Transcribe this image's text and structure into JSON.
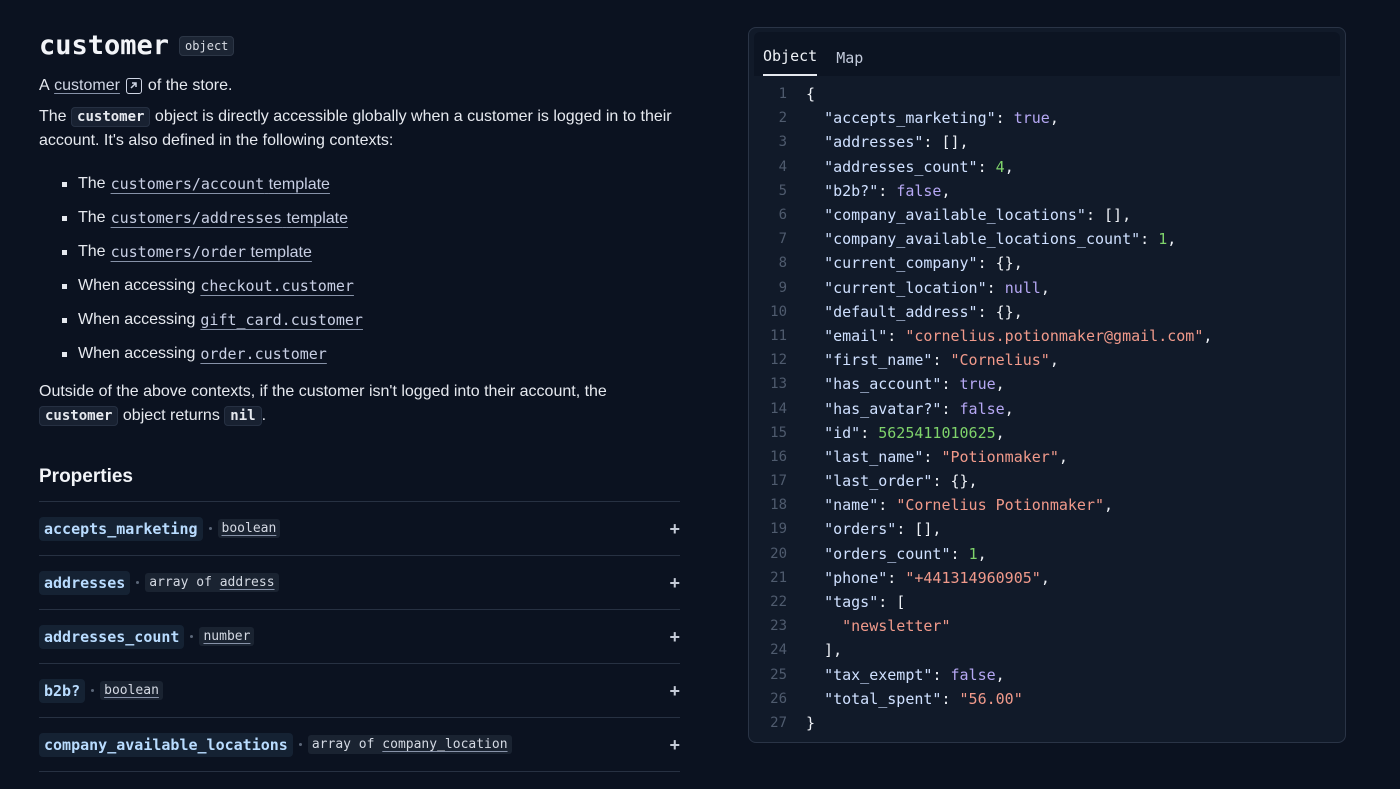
{
  "header": {
    "title": "customer",
    "type_badge": "object"
  },
  "intro": {
    "prefix": "A",
    "link": "customer",
    "suffix": "of the store."
  },
  "description": {
    "p1_before": "The",
    "p1_code": "customer",
    "p1_after": "object is directly accessible globally when a customer is logged in to their account. It's also defined in the following contexts:",
    "p2_before": "Outside of the above contexts, if the customer isn't logged into their account, the",
    "p2_code": "customer",
    "p2_middle": "object returns",
    "p2_code2": "nil",
    "p2_end": "."
  },
  "contexts": [
    {
      "prefix": "The",
      "code": "customers/account",
      "suffix": "template"
    },
    {
      "prefix": "The",
      "code": "customers/addresses",
      "suffix": "template"
    },
    {
      "prefix": "The",
      "code": "customers/order",
      "suffix": "template"
    },
    {
      "prefix": "When accessing",
      "code": "checkout.customer",
      "suffix": ""
    },
    {
      "prefix": "When accessing",
      "code": "gift_card.customer",
      "suffix": ""
    },
    {
      "prefix": "When accessing",
      "code": "order.customer",
      "suffix": ""
    }
  ],
  "properties": {
    "heading": "Properties",
    "expand_icon": "plus-icon",
    "items": [
      {
        "name": "accepts_marketing",
        "type_prefix": "",
        "type": "boolean"
      },
      {
        "name": "addresses",
        "type_prefix": "array of",
        "type": "address"
      },
      {
        "name": "addresses_count",
        "type_prefix": "",
        "type": "number"
      },
      {
        "name": "b2b?",
        "type_prefix": "",
        "type": "boolean"
      },
      {
        "name": "company_available_locations",
        "type_prefix": "array of",
        "type": "company_location"
      }
    ]
  },
  "panel": {
    "tabs": [
      "Object",
      "Map"
    ],
    "active_tab": "Object",
    "lines": [
      "{",
      "  \"accepts_marketing\": true,",
      "  \"addresses\": [],",
      "  \"addresses_count\": 4,",
      "  \"b2b?\": false,",
      "  \"company_available_locations\": [],",
      "  \"company_available_locations_count\": 1,",
      "  \"current_company\": {},",
      "  \"current_location\": null,",
      "  \"default_address\": {},",
      "  \"email\": \"cornelius.potionmaker@gmail.com\",",
      "  \"first_name\": \"Cornelius\",",
      "  \"has_account\": true,",
      "  \"has_avatar?\": false,",
      "  \"id\": 5625411010625,",
      "  \"last_name\": \"Potionmaker\",",
      "  \"last_order\": {},",
      "  \"name\": \"Cornelius Potionmaker\",",
      "  \"orders\": [],",
      "  \"orders_count\": 1,",
      "  \"phone\": \"+441314960905\",",
      "  \"tags\": [",
      "    \"newsletter\"",
      "  ],",
      "  \"tax_exempt\": false,",
      "  \"total_spent\": \"56.00\"",
      "}"
    ]
  },
  "colors": {
    "background": "#0b1220",
    "key": "#cfe0ff",
    "string": "#f19a8b",
    "number": "#7fd36b",
    "literal": "#b6a8f4"
  }
}
